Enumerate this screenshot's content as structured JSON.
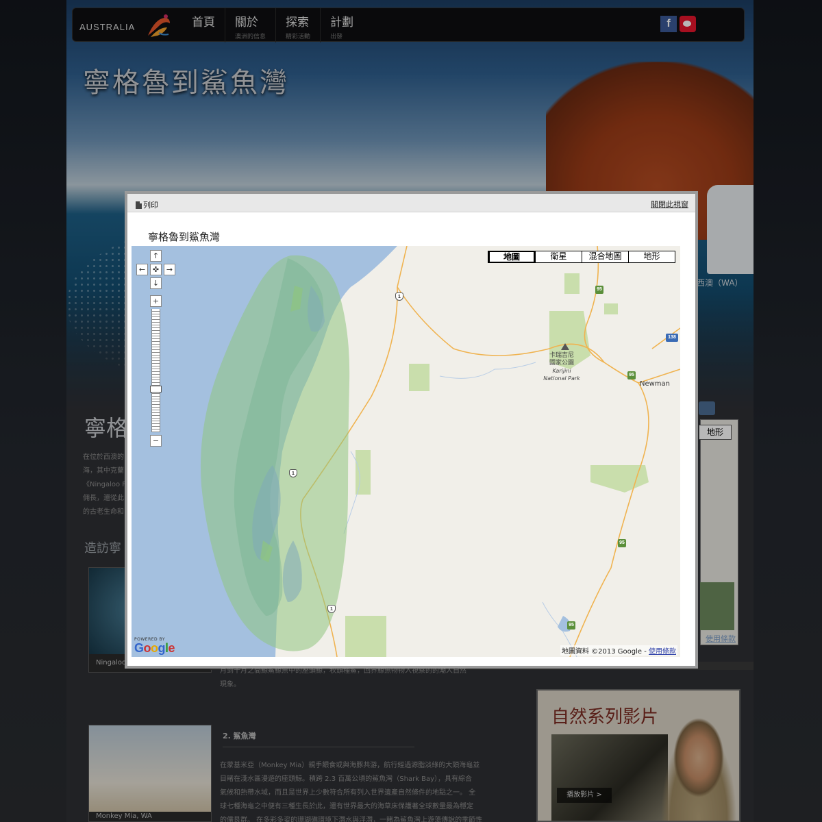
{
  "nav": {
    "logo_text": "AUSTRALIA",
    "items": [
      {
        "label": "首頁",
        "sub": ""
      },
      {
        "label": "關於",
        "sub": "澳洲的信息"
      },
      {
        "label": "探索",
        "sub": "精彩活動"
      },
      {
        "label": "計劃",
        "sub": "出發"
      }
    ],
    "social": {
      "facebook_glyph": "f"
    }
  },
  "page": {
    "hero_title": "寧格魯到鯊魚灣",
    "wa_label": "西澳（WA）",
    "content_title": "寧格",
    "intro_lines": [
      "在位於西澳的",
      "海，其中克蘭",
      "《Ningaloo F",
      "佣長，還從此",
      "的古老生命和"
    ],
    "visit_heading": "造訪寧",
    "thumb1_caption": "Ningaloo",
    "small_map_button": "地形",
    "small_map_link": "使用條款",
    "text_under_modal": [
      "月到十月之間鯨鯊鯨魚中的座頭鯨，秋頭種鯊，回界鯨魚物物入視察的的潮人自然",
      "現象。"
    ],
    "section2_title": "2. 鯊魚灣",
    "section2_lines": [
      "在蒙基米亞（Monkey Mia）親手餵食或與海豚共游，航行經過源脂淡綠的大頭海龜並",
      "目睹在淺水區漫遊的座頭鯨。積跨 2.3 百萬公頃的鯊魚灣（Shark Bay），具有綜合",
      "氣候和熱帶水域，而且是世界上少數符合所有列入世界遺產自然條件的地點之一。 全",
      "球七種海龜之中便有三種生長於此，還有世界最大的海草床保護著全球數量最為穩定",
      "的儒艮群。 在多彩多姿的珊瑚礁環境下潛水與浮潛，一睹為鯊魚灣上遊蕩傳說的季節性"
    ],
    "thumb2_caption": "Monkey Mia, WA",
    "video_title": "自然系列影片",
    "video_play": "播放影片 >"
  },
  "modal": {
    "print_label": "列印",
    "close_label": "關閉此視窗",
    "title": "寧格魯到鯊魚灣",
    "map": {
      "type_buttons": [
        {
          "label": "地圖",
          "active": true
        },
        {
          "label": "衛星",
          "active": false
        },
        {
          "label": "混合地圖",
          "active": false
        },
        {
          "label": "地形",
          "active": false
        }
      ],
      "pan_glyphs": {
        "up": "↑",
        "left": "←",
        "center": "✜",
        "right": "→",
        "down": "↓"
      },
      "zoom": {
        "in": "+",
        "out": "−"
      },
      "powered_label": "POWERED BY",
      "google_letters": [
        "G",
        "o",
        "o",
        "g",
        "l",
        "e"
      ],
      "attribution": "地圖資料 ©2013 Google - ",
      "terms_link": "使用條款",
      "park_label_line1": "卡瑞吉尼",
      "park_label_line2": "國家公園",
      "park_label_en1": "Karijini",
      "park_label_en2": "National Park",
      "city_label": "Newman",
      "road_shields": [
        "1",
        "95",
        "138",
        "95",
        "1",
        "95",
        "1",
        "95"
      ],
      "colors": {
        "water": "#a4c0df",
        "land": "#f1efe9",
        "region_fill": "#8fc47f",
        "parks": "#c9deac",
        "roads": "#f0b350"
      }
    }
  }
}
